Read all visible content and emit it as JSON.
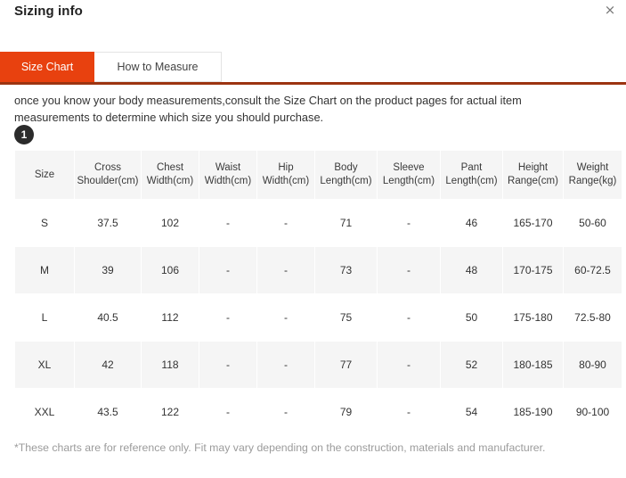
{
  "modal": {
    "title": "Sizing info",
    "close_icon": "close-icon",
    "close_label": "×"
  },
  "tabs": [
    {
      "label": "Size Chart",
      "active": true
    },
    {
      "label": "How to Measure",
      "active": false
    }
  ],
  "description": {
    "text": "once you know your body measurements,consult the Size Chart on the product pages for actual item measurements to determine which size you should purchase.",
    "step_badge": "1"
  },
  "colors": {
    "accent": "#e8410f",
    "underline": "#9c3411",
    "header_cell_bg": "#f5f5f5",
    "badge_bg": "#2b2b2b",
    "footnote_text": "#9b9b9b"
  },
  "chart_data": {
    "type": "table",
    "title": "Size Chart",
    "columns": [
      "Size",
      "Cross Shoulder(cm)",
      "Chest Width(cm)",
      "Waist Width(cm)",
      "Hip Width(cm)",
      "Body Length(cm)",
      "Sleeve Length(cm)",
      "Pant Length(cm)",
      "Height Range(cm)",
      "Weight Range(kg)"
    ],
    "column_lines": [
      [
        "Size",
        ""
      ],
      [
        "Cross",
        "Shoulder(cm)"
      ],
      [
        "Chest",
        "Width(cm)"
      ],
      [
        "Waist",
        "Width(cm)"
      ],
      [
        "Hip",
        "Width(cm)"
      ],
      [
        "Body",
        "Length(cm)"
      ],
      [
        "Sleeve",
        "Length(cm)"
      ],
      [
        "Pant",
        "Length(cm)"
      ],
      [
        "Height",
        "Range(cm)"
      ],
      [
        "Weight",
        "Range(kg)"
      ]
    ],
    "rows": [
      [
        "S",
        "37.5",
        "102",
        "-",
        "-",
        "71",
        "-",
        "46",
        "165-170",
        "50-60"
      ],
      [
        "M",
        "39",
        "106",
        "-",
        "-",
        "73",
        "-",
        "48",
        "170-175",
        "60-72.5"
      ],
      [
        "L",
        "40.5",
        "112",
        "-",
        "-",
        "75",
        "-",
        "50",
        "175-180",
        "72.5-80"
      ],
      [
        "XL",
        "42",
        "118",
        "-",
        "-",
        "77",
        "-",
        "52",
        "180-185",
        "80-90"
      ],
      [
        "XXL",
        "43.5",
        "122",
        "-",
        "-",
        "79",
        "-",
        "54",
        "185-190",
        "90-100"
      ]
    ]
  },
  "footnote": "*These charts are for reference only. Fit may vary depending on the construction, materials and manufacturer."
}
